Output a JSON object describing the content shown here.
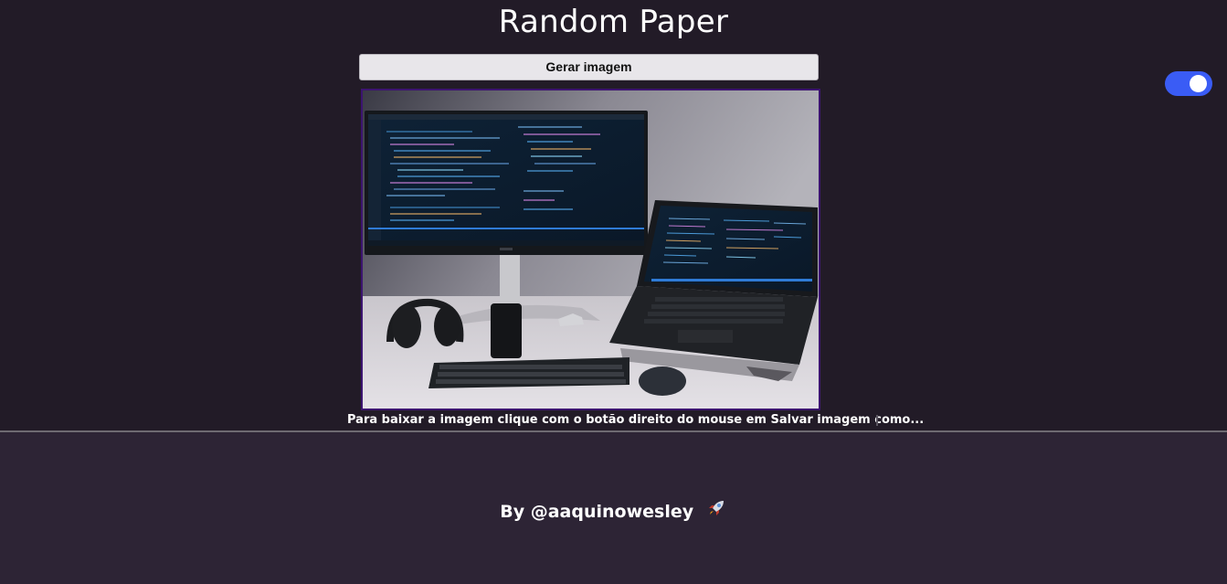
{
  "header": {
    "title": "Random Paper"
  },
  "controls": {
    "generate_label": "Gerar imagem",
    "theme_toggle": {
      "on": true,
      "color": "#3a5cf5"
    }
  },
  "image": {
    "alt": "Desk setup with monitor and laptop showing code"
  },
  "hint": {
    "text": "Para baixar a imagem clique com o botão direito do mouse em Salvar imagem como..."
  },
  "footer": {
    "credit": "By @aaquinowesley",
    "icon": "rocket-icon"
  },
  "colors": {
    "background": "#221b27",
    "footer": "#2d2435",
    "image_border": "#3c1470"
  }
}
